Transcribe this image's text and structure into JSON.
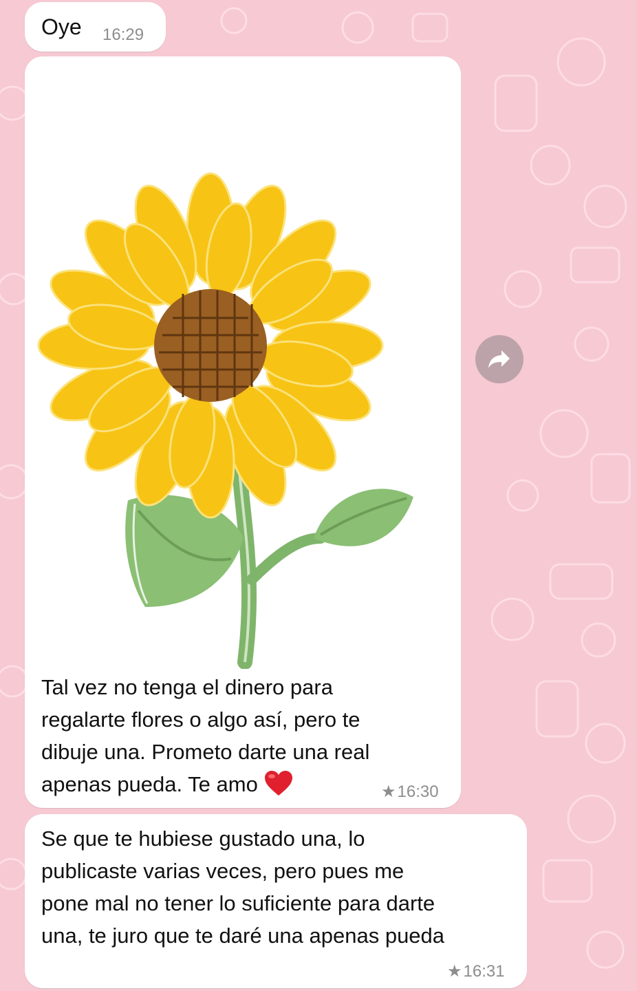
{
  "messages": [
    {
      "text": "Oye",
      "time": "16:29",
      "starred": false
    },
    {
      "text": "Tal vez no tenga el dinero para\nregalarte flores o algo así, pero te\ndibuje una. Prometo darte una real\napenas pueda. Te amo",
      "emoji": "heart-emoji",
      "time": "16:30",
      "starred": true,
      "image": "sunflower-drawing"
    },
    {
      "text": "Se que te hubiese gustado una, lo\npublicaste varias veces, pero pues me\npone mal no tener lo suficiente para darte\nuna, te juro que te daré una apenas pueda",
      "time": "16:31",
      "starred": true
    }
  ],
  "icons": {
    "forward": "forward-arrow-icon",
    "star": "star-icon"
  },
  "colors": {
    "wallpaper": "#f6c9d3",
    "bubble": "#ffffff",
    "petal": "#f7c315",
    "leaf": "#8bbf74"
  }
}
